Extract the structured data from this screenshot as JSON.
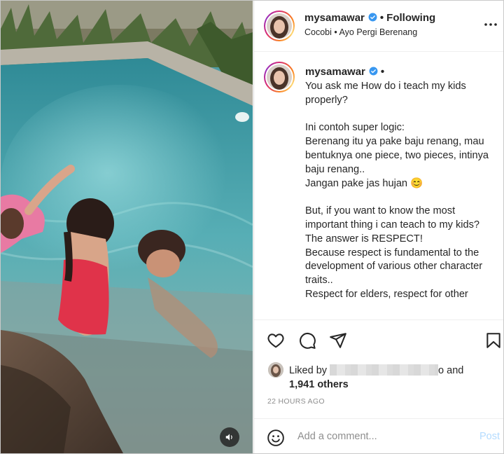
{
  "post": {
    "author": "mysamawar",
    "follow_status": "Following",
    "subtitle": "Cocobi • Ayo Pergi Berenang",
    "caption_author": "mysamawar",
    "caption": "You ask me How do i teach my kids properly?\n\nIni contoh super logic:\nBerenang itu ya pake baju renang, mau bentuknya one piece, two pieces, intinya baju renang..\nJangan pake jas hujan 😊\n\nBut, if you want to know the most important thing i can teach to my kids?\nThe answer is RESPECT!\nBecause respect is fundamental to the development of various other character traits..\nRespect for elders, respect for other",
    "likes_prefix": "Liked by",
    "likes_suffix": "o and",
    "likes_count": "1,941 others",
    "timestamp": "22 HOURS AGO",
    "comment_placeholder": "Add a comment...",
    "post_label": "Post"
  },
  "icons": {
    "verified": "verified-badge-icon",
    "more": "more-options-icon",
    "like": "heart-icon",
    "comment": "comment-bubble-icon",
    "share": "paper-plane-icon",
    "save": "bookmark-icon",
    "emoji": "emoji-smiley-icon",
    "sound": "speaker-icon"
  },
  "colors": {
    "verified_blue": "#3897f0",
    "post_button": "#b3dbff",
    "muted_text": "#8e8e8e"
  }
}
